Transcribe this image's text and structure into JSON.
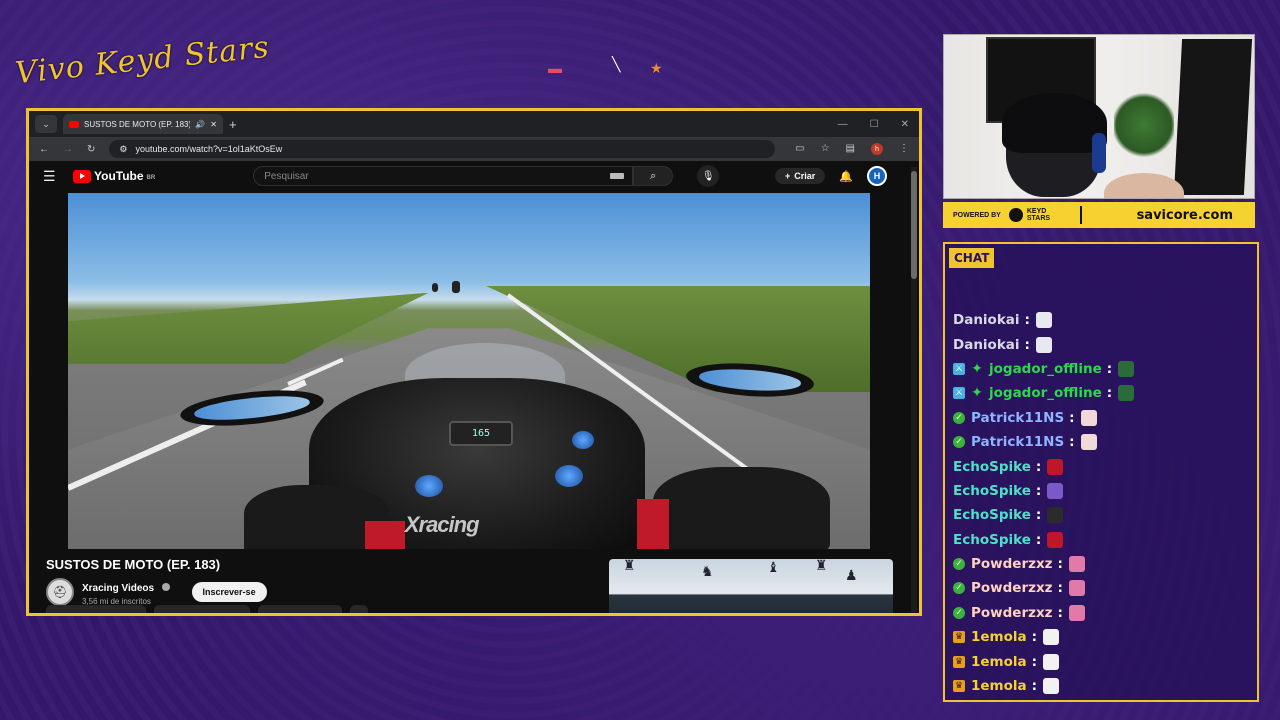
{
  "overlay": {
    "logo_text": "Vivo Keyd Stars"
  },
  "browser": {
    "tab_title": "SUSTOS DE MOTO (EP. 183)",
    "url": "youtube.com/watch?v=1ol1aKtOsEw",
    "profile_initial": "h"
  },
  "youtube": {
    "logo": "YouTube",
    "country": "BR",
    "search_placeholder": "Pesquisar",
    "create_label": "Criar",
    "avatar_initial": "H"
  },
  "video": {
    "speed_readout": "165",
    "watermark": "Xracing",
    "title": "SUSTOS DE MOTO (EP. 183)",
    "channel_name": "Xracing Videos",
    "subscribers": "3,56 mi de inscritos",
    "subscribe_label": "Inscrever-se"
  },
  "sponsor": {
    "powered_by": "POWERED BY",
    "brand_line1": "KEYD",
    "brand_line2": "STARS",
    "site": "savicore.com"
  },
  "chat": {
    "header": "CHAT",
    "messages": [
      {
        "badge": "",
        "user": "Daniokai",
        "color": "#d9d9e6"
      },
      {
        "badge": "",
        "user": "Daniokai",
        "color": "#d9d9e6"
      },
      {
        "badge": "mod",
        "user": "jogador_offline",
        "color": "#2bd94a"
      },
      {
        "badge": "mod",
        "user": "jogador_offline",
        "color": "#2bd94a"
      },
      {
        "badge": "check",
        "user": "Patrick11NS",
        "color": "#8fb4ff"
      },
      {
        "badge": "check",
        "user": "Patrick11NS",
        "color": "#8fb4ff"
      },
      {
        "badge": "",
        "user": "EchoSpike",
        "color": "#4fe0c8"
      },
      {
        "badge": "",
        "user": "EchoSpike",
        "color": "#4fe0c8"
      },
      {
        "badge": "",
        "user": "EchoSpike",
        "color": "#4fe0c8"
      },
      {
        "badge": "",
        "user": "EchoSpike",
        "color": "#4fe0c8"
      },
      {
        "badge": "check",
        "user": "Powderzxz",
        "color": "#ffd2c0"
      },
      {
        "badge": "check",
        "user": "Powderzxz",
        "color": "#ffd2c0"
      },
      {
        "badge": "check",
        "user": "Powderzxz",
        "color": "#ffd2c0"
      },
      {
        "badge": "crown",
        "user": "1emola",
        "color": "#f5d22f"
      },
      {
        "badge": "crown",
        "user": "1emola",
        "color": "#f5d22f"
      },
      {
        "badge": "crown",
        "user": "1emola",
        "color": "#f5d22f"
      }
    ],
    "colon": ":"
  }
}
